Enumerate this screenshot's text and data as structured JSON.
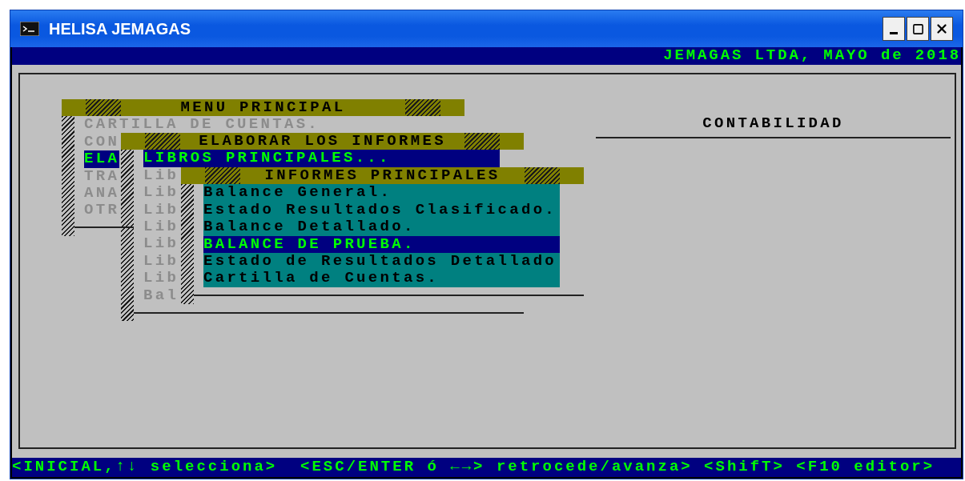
{
  "window": {
    "title": "HELISA JEMAGAS"
  },
  "header": {
    "company": "JEMAGAS LTDA, MAYO de 2018"
  },
  "menus": [
    {
      "title": "MENU PRINCIPAL",
      "active": false,
      "items": [
        {
          "label": "CARTILLA DE CUENTAS.",
          "selected": false
        },
        {
          "label": "CON",
          "selected": false
        },
        {
          "label": "ELA",
          "selected": true
        },
        {
          "label": "TRA",
          "selected": false
        },
        {
          "label": "ANA",
          "selected": false
        },
        {
          "label": "OTR",
          "selected": false
        }
      ]
    },
    {
      "title": "ELABORAR LOS INFORMES",
      "active": false,
      "items": [
        {
          "label": "LIBROS PRINCIPALES...",
          "selected": true
        },
        {
          "label": "Lib",
          "selected": false
        },
        {
          "label": "Lib",
          "selected": false
        },
        {
          "label": "Lib",
          "selected": false
        },
        {
          "label": "Lib",
          "selected": false
        },
        {
          "label": "Lib",
          "selected": false
        },
        {
          "label": "Lib",
          "selected": false
        },
        {
          "label": "Lib",
          "selected": false
        },
        {
          "label": "Bal",
          "selected": false
        }
      ]
    },
    {
      "title": "INFORMES PRINCIPALES",
      "active": true,
      "items": [
        {
          "label": "Balance General.",
          "selected": false
        },
        {
          "label": "Estado Resultados Clasificado.",
          "selected": false
        },
        {
          "label": "Balance Detallado.",
          "selected": false
        },
        {
          "label": "BALANCE DE PRUEBA.",
          "selected": true
        },
        {
          "label": "Estado de Resultados Detallado",
          "selected": false
        },
        {
          "label": "Cartilla de Cuentas.",
          "selected": false
        }
      ]
    }
  ],
  "side_panel": {
    "title": "CONTABILIDAD"
  },
  "status_bar": {
    "text": "<INICIAL,↑↓ selecciona>  <ESC/ENTER ó ←→> retrocede/avanza> <ShifT> <F10 editor>"
  }
}
